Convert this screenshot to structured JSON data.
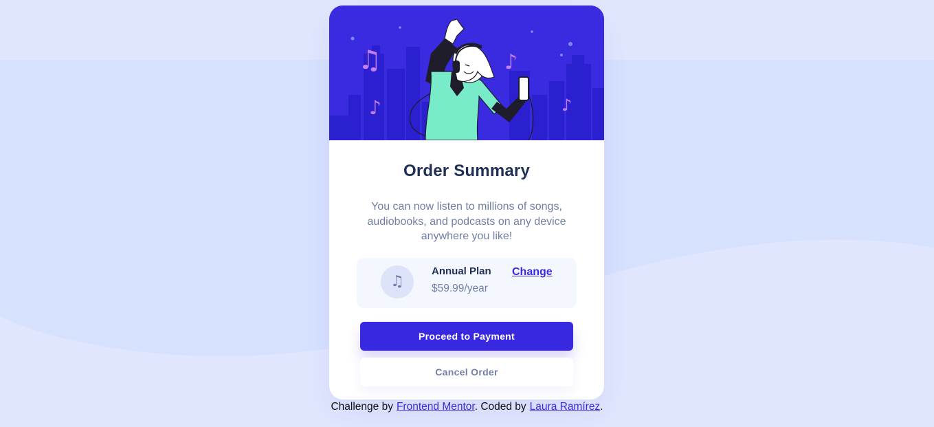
{
  "card": {
    "title": "Order Summary",
    "description": "You can now listen to millions of songs, audiobooks, and podcasts on any device anywhere you like!",
    "hero_illustration": "person-dancing-with-headphones-illustration"
  },
  "plan": {
    "icon": "music-note-icon",
    "name": "Annual Plan",
    "price": "$59.99/year",
    "change_label": "Change"
  },
  "actions": {
    "proceed_label": "Proceed to Payment",
    "cancel_label": "Cancel Order"
  },
  "attribution": {
    "prefix": "Challenge by",
    "link1": "Frontend Mentor",
    "middle": ". Coded by",
    "link2": "Laura Ramírez",
    "suffix": "."
  },
  "colors": {
    "page_bg": "#e0e6fd",
    "pattern": "#d5e1ff",
    "accent": "#3829e0",
    "title": "#1f2f56",
    "muted": "#717fa6",
    "plan_bg": "#f5f7ff"
  }
}
